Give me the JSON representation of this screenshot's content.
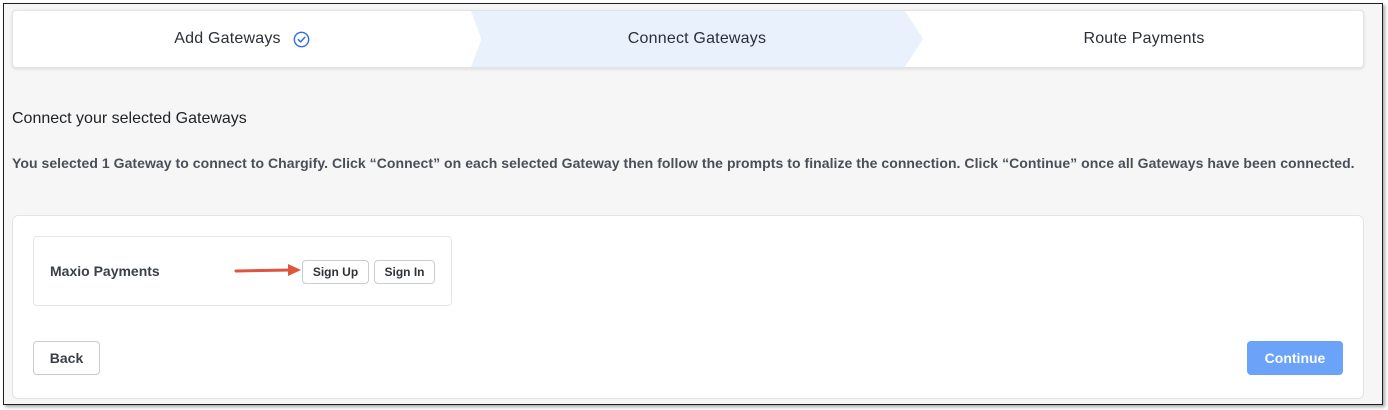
{
  "stepper": {
    "steps": [
      {
        "label": "Add Gateways",
        "state": "completed",
        "icon": "check-circle-icon"
      },
      {
        "label": "Connect Gateways",
        "state": "active"
      },
      {
        "label": "Route Payments",
        "state": "pending"
      }
    ]
  },
  "main": {
    "title": "Connect your selected Gateways",
    "description": "You selected 1 Gateway to connect to Chargify. Click “Connect” on each selected Gateway then follow the prompts to finalize the connection. Click “Continue” once all Gateways have been connected."
  },
  "gateways": [
    {
      "name": "Maxio Payments",
      "sign_up_label": "Sign Up",
      "sign_in_label": "Sign In"
    }
  ],
  "footer": {
    "back_label": "Back",
    "continue_label": "Continue"
  },
  "colors": {
    "active_step_bg": "#e8f1fc",
    "check_icon": "#2f6fe4",
    "continue_button": "#6aa3f8",
    "annotation_arrow": "#e0553f"
  }
}
